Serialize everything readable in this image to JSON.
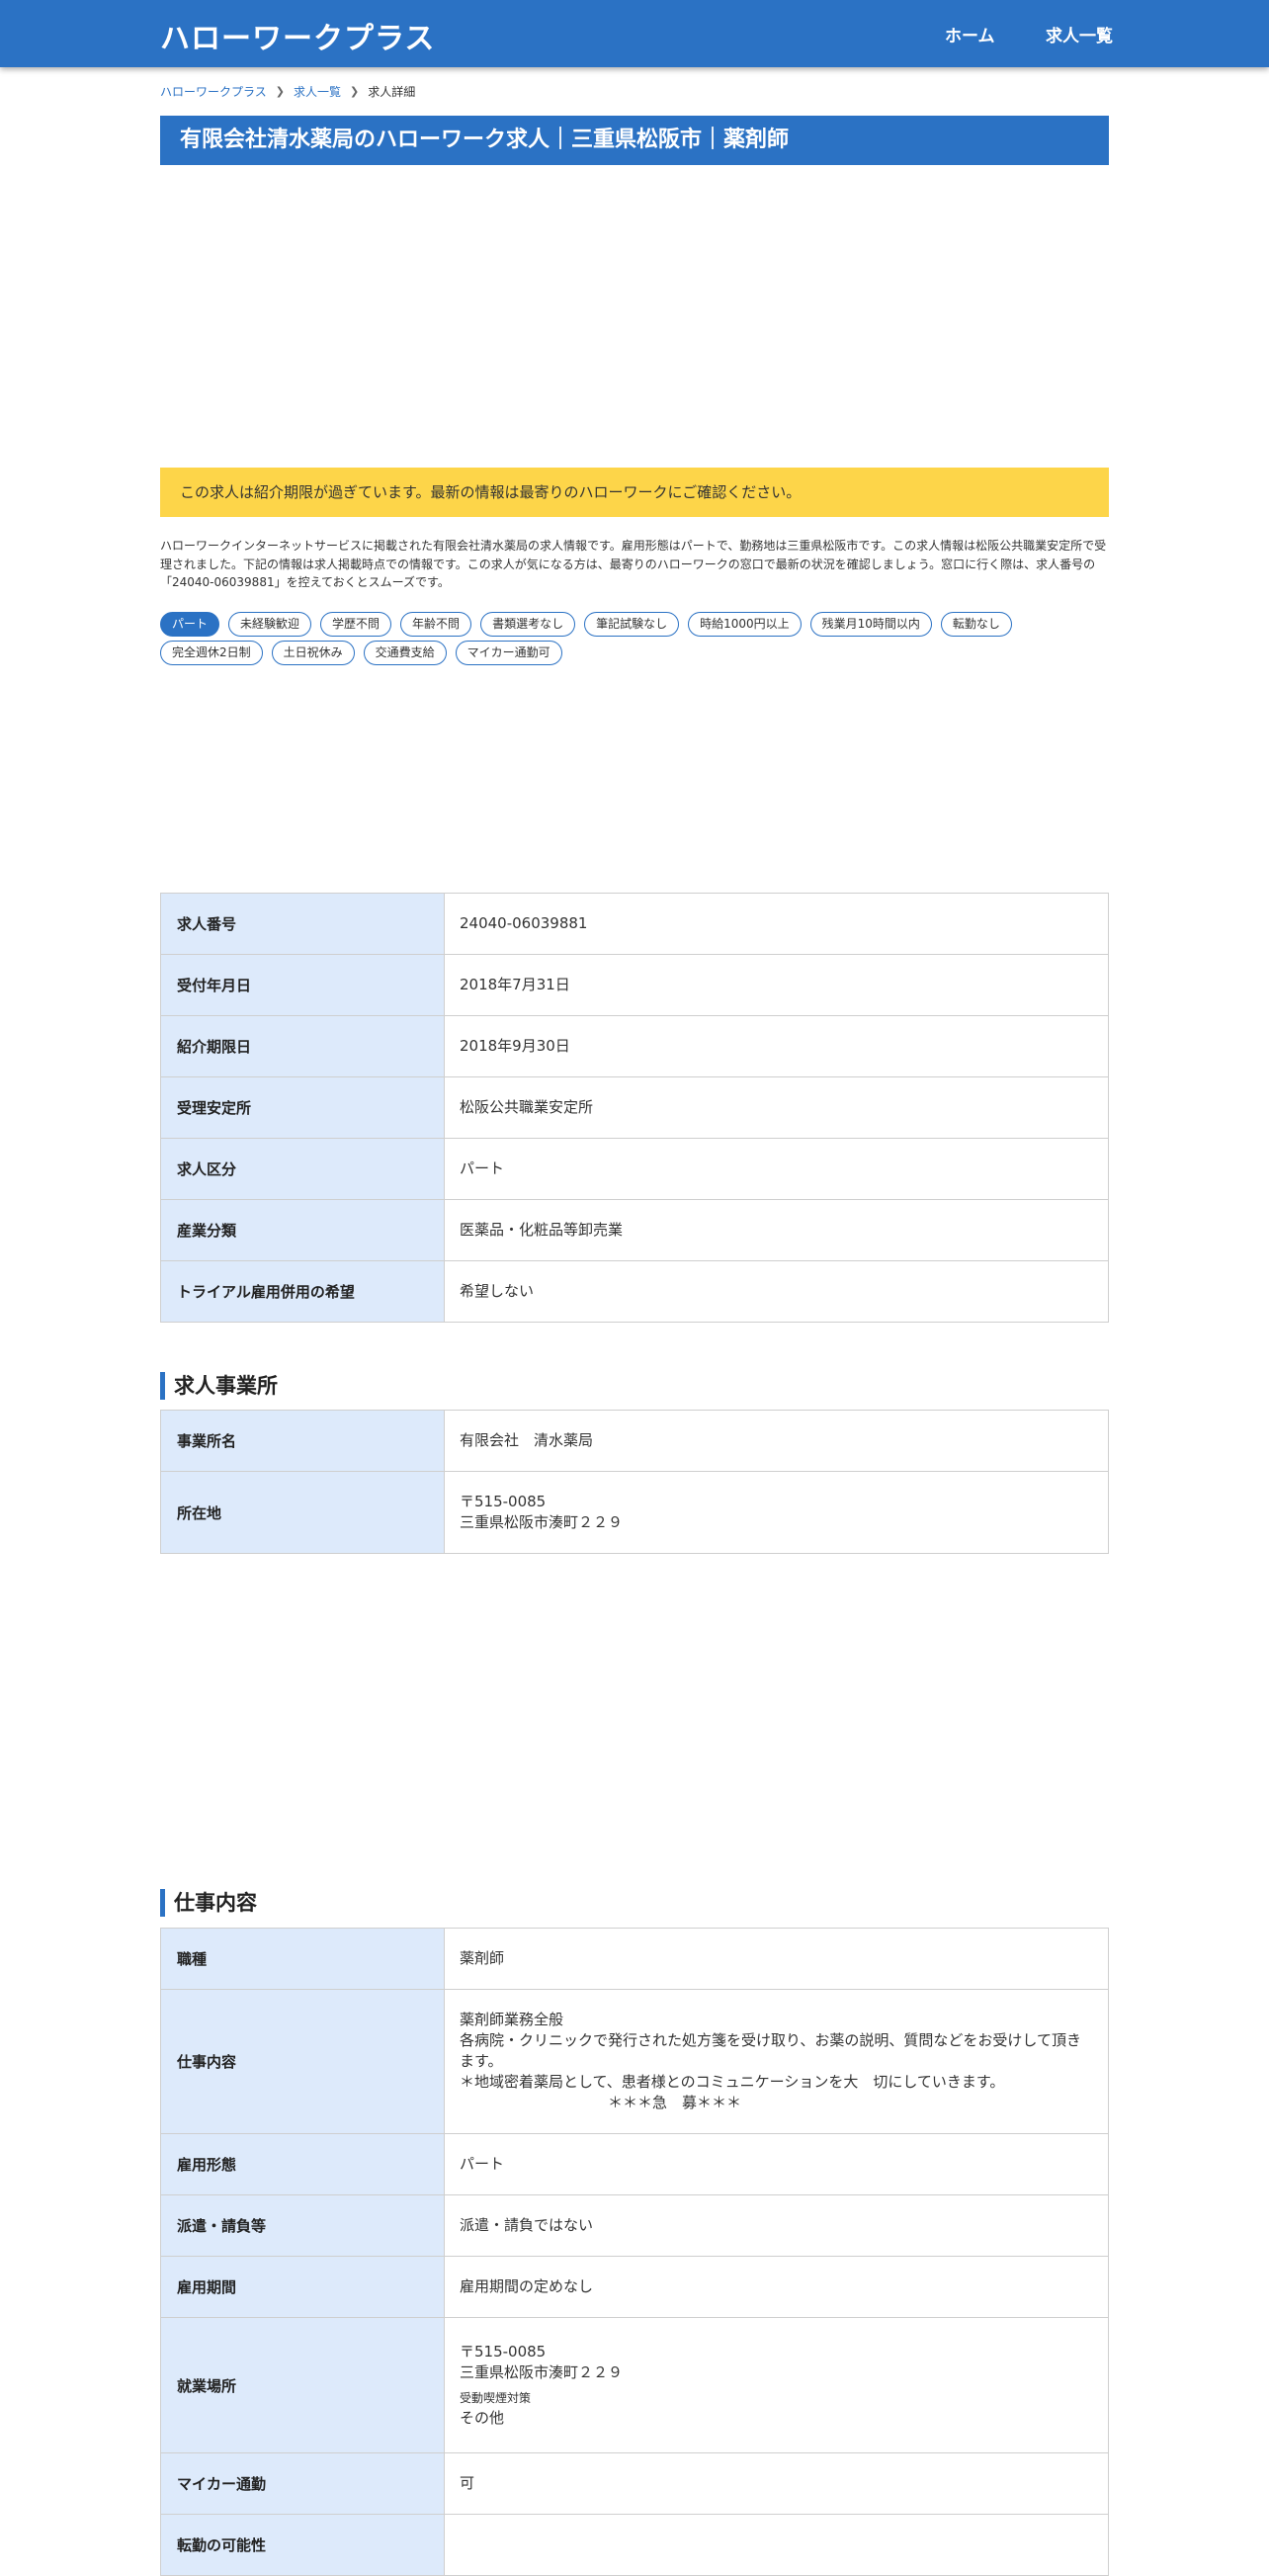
{
  "header": {
    "logo": "ハローワークプラス",
    "nav": [
      {
        "label": "ホーム"
      },
      {
        "label": "求人一覧"
      }
    ]
  },
  "breadcrumb": {
    "items": [
      "ハローワークプラス",
      "求人一覧",
      "求人詳細"
    ]
  },
  "page_title": "有限会社清水薬局のハローワーク求人｜三重県松阪市｜薬剤師",
  "notice": "この求人は紹介期限が過ぎています。最新の情報は最寄りのハローワークにご確認ください。",
  "description": "ハローワークインターネットサービスに掲載された有限会社清水薬局の求人情報です。雇用形態はパートで、勤務地は三重県松阪市です。この求人情報は松阪公共職業安定所で受理されました。下記の情報は求人掲載時点での情報です。この求人が気になる方は、最寄りのハローワークの窓口で最新の状況を確認しましょう。窓口に行く際は、求人番号の「24040-06039881」を控えておくとスムーズです。",
  "tags": [
    "パート",
    "未経験歓迎",
    "学歴不問",
    "年齢不問",
    "書類選考なし",
    "筆記試験なし",
    "時給1000円以上",
    "残業月10時間以内",
    "転勤なし",
    "完全週休2日制",
    "土日祝休み",
    "交通費支給",
    "マイカー通勤可"
  ],
  "basic_info": {
    "rows": [
      {
        "label": "求人番号",
        "value": "24040-06039881"
      },
      {
        "label": "受付年月日",
        "value": "2018年7月31日"
      },
      {
        "label": "紹介期限日",
        "value": "2018年9月30日"
      },
      {
        "label": "受理安定所",
        "value": "松阪公共職業安定所"
      },
      {
        "label": "求人区分",
        "value": "パート"
      },
      {
        "label": "産業分類",
        "value": "医薬品・化粧品等卸売業"
      },
      {
        "label": "トライアル雇用併用の希望",
        "value": "希望しない"
      }
    ]
  },
  "office": {
    "heading": "求人事業所",
    "name_label": "事業所名",
    "name_value": "有限会社　清水薬局",
    "address_label": "所在地",
    "postal": "〒515-0085",
    "address": "三重県松阪市湊町２２９"
  },
  "job": {
    "heading": "仕事内容",
    "occupation_label": "職種",
    "occupation_value": "薬剤師",
    "content_label": "仕事内容",
    "content_lines": [
      "薬剤師業務全般",
      "各病院・クリニックで発行された処方箋を受け取り、お薬の説明、質問などをお受けして頂きます。",
      "＊地域密着薬局として、患者様とのコミュニケーションを大　切にしていきます。",
      "　　　　　　　　　　＊＊＊急　募＊＊＊"
    ],
    "employment_label": "雇用形態",
    "employment_value": "パート",
    "dispatch_label": "派遣・請負等",
    "dispatch_value": "派遣・請負ではない",
    "period_label": "雇用期間",
    "period_value": "雇用期間の定めなし",
    "workplace_label": "就業場所",
    "workplace_postal": "〒515-0085",
    "workplace_address": "三重県松阪市湊町２２９",
    "smoking_label": "受動喫煙対策",
    "smoking_value": "その他",
    "car_label": "マイカー通勤",
    "car_value": "可",
    "next_label": "転勤の可能性"
  }
}
